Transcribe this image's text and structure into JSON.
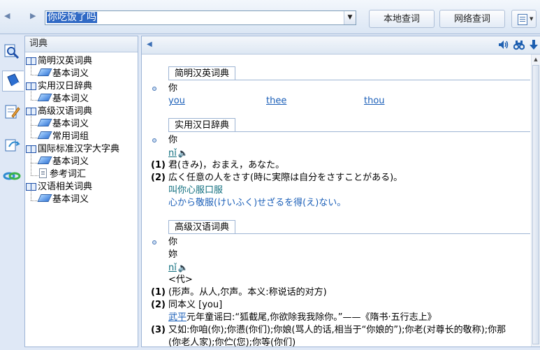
{
  "toolbar": {
    "back_icon": "left-arrow-icon",
    "forward_icon": "right-arrow-icon",
    "search_value": "你吃饭了吗",
    "local_query_label": "本地查词",
    "web_query_label": "网络查词",
    "menu_icon": "document-menu-icon"
  },
  "leftbar": {
    "icons": [
      "lookup-icon",
      "dictionary-book-icon",
      "edit-note-icon",
      "translate-icon",
      "link-icon"
    ]
  },
  "tree": {
    "title": "词典",
    "items": [
      {
        "label": "简明汉英词典",
        "level": 0
      },
      {
        "label": "基本词义",
        "level": 1
      },
      {
        "label": "实用汉日辞典",
        "level": 0
      },
      {
        "label": "基本词义",
        "level": 1
      },
      {
        "label": "高级汉语词典",
        "level": 0
      },
      {
        "label": "基本词义",
        "level": 1
      },
      {
        "label": "常用词组",
        "level": 1
      },
      {
        "label": "国际标准汉字大字典",
        "level": 0
      },
      {
        "label": "基本词义",
        "level": 1
      },
      {
        "label": "参考词汇",
        "level": 1
      },
      {
        "label": "汉语相关词典",
        "level": 0
      },
      {
        "label": "基本词义",
        "level": 1
      }
    ]
  },
  "content": {
    "header_icons": [
      "speaker-icon",
      "binoculars-icon",
      "download-arrow-icon"
    ],
    "sections": {
      "s1": {
        "title": "简明汉英词典",
        "word": "你",
        "links": [
          "you",
          "thee",
          "thou"
        ]
      },
      "s2": {
        "title": "实用汉日辞典",
        "word": "你",
        "pinyin": "nǐ",
        "n1": "(1)",
        "def1": "君(きみ)，おまえ，あなた。",
        "n2": "(2)",
        "def2": "広く任意の人をさす(時に実際は自分をさすことがある)。",
        "ex_cn": "叫你心服口服",
        "ex_jp": "心から敬服(けいふく)せざるを得(え)ない。"
      },
      "s3": {
        "title": "高级汉语词典",
        "word1": "你",
        "word2": "妳",
        "pinyin": "nǐ",
        "pos": "<代>",
        "n1": "(1)",
        "def1": "(形声。从人,尔声。本义:称说话的对方)",
        "n2": "(2)",
        "def2": "同本义 [you]",
        "quote_link": "武平",
        "quote_rest": "元年童谣曰:“狐截尾,你欲除我我除你。”——《隋书·五行志上》",
        "n3": "(3)",
        "def3a": "又如:你咱(你);你懑(你们);你娘(骂人的话,相当于“你娘的”);你老(对尊长的敬称);你那",
        "def3b": "(你老人家);你伫(您);你等(你们)"
      }
    }
  }
}
